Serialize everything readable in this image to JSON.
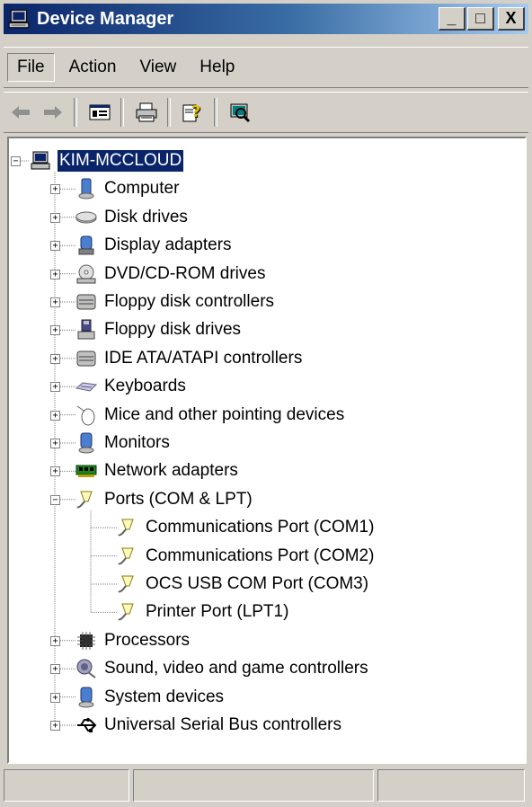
{
  "window": {
    "title": "Device Manager"
  },
  "caption": {
    "minimize": "_",
    "maximize": "□",
    "close": "X"
  },
  "menu": {
    "items": [
      "File",
      "Action",
      "View",
      "Help"
    ]
  },
  "toolbar": {
    "buttons": [
      "back-icon",
      "forward-icon",
      "show-hide-console-tree-icon",
      "print-icon",
      "help-icon",
      "scan-hardware-icon"
    ]
  },
  "tree": {
    "root": "KIM-MCCLOUD",
    "categories": [
      {
        "label": "Computer",
        "icon": "computer-icon",
        "expanded": false
      },
      {
        "label": "Disk drives",
        "icon": "disk-drive-icon",
        "expanded": false
      },
      {
        "label": "Display adapters",
        "icon": "display-adapter-icon",
        "expanded": false
      },
      {
        "label": "DVD/CD-ROM drives",
        "icon": "cdrom-icon",
        "expanded": false
      },
      {
        "label": "Floppy disk controllers",
        "icon": "floppy-controller-icon",
        "expanded": false
      },
      {
        "label": "Floppy disk drives",
        "icon": "floppy-drive-icon",
        "expanded": false
      },
      {
        "label": "IDE ATA/ATAPI controllers",
        "icon": "ide-controller-icon",
        "expanded": false
      },
      {
        "label": "Keyboards",
        "icon": "keyboard-icon",
        "expanded": false
      },
      {
        "label": "Mice and other pointing devices",
        "icon": "mouse-icon",
        "expanded": false
      },
      {
        "label": "Monitors",
        "icon": "monitor-icon",
        "expanded": false
      },
      {
        "label": "Network adapters",
        "icon": "network-adapter-icon",
        "expanded": false
      },
      {
        "label": "Ports (COM & LPT)",
        "icon": "port-icon",
        "expanded": true,
        "children": [
          "Communications Port (COM1)",
          "Communications Port (COM2)",
          "OCS USB COM Port (COM3)",
          "Printer Port (LPT1)"
        ]
      },
      {
        "label": "Processors",
        "icon": "processor-icon",
        "expanded": false
      },
      {
        "label": "Sound, video and game controllers",
        "icon": "sound-icon",
        "expanded": false
      },
      {
        "label": "System devices",
        "icon": "system-device-icon",
        "expanded": false
      },
      {
        "label": "Universal Serial Bus controllers",
        "icon": "usb-icon",
        "expanded": false
      }
    ]
  },
  "status": {
    "cells": [
      "",
      "",
      ""
    ]
  }
}
